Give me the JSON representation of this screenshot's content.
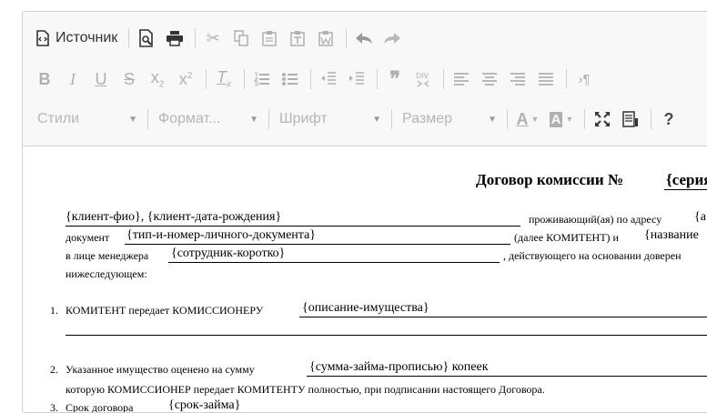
{
  "toolbar": {
    "source_label": "Источник",
    "styles_label": "Стили",
    "format_label": "Формат...",
    "font_label": "Шрифт",
    "size_label": "Размер"
  },
  "document": {
    "title": "Договор комиссии №",
    "title_serial": "{серия",
    "p1_client": "{клиент-фио}, {клиент-дата-рождения}",
    "p1_lives": "проживающий(ая) по адресу",
    "p1_lives_tail": "{а",
    "p2_doc": "документ",
    "p2_doc_ph": "{тип-и-номер-личного-документа}",
    "p2_komitent": "(далее КОМИТЕНТ) и",
    "p2_name": "{название",
    "p3_face": "в лице менеджера",
    "p3_manager": "{сотрудник-коротко}",
    "p3_acting": ", действующего на основании доверен",
    "p4_following": "нижеследующем:",
    "item1_num": "1.",
    "item1_text": "КОМИТЕНТ передает КОМИССИОНЕРУ",
    "item1_ph": "{описание-имущества}",
    "item2_num": "2.",
    "item2_text": "Указанное имущество оценено на сумму",
    "item2_ph": "{сумма-займа-прописью} копеек",
    "item2_line2": "которую КОМИССИОНЕР передает КОМИТЕНТУ полностью, при подписании настоящего Договора.",
    "item3_num": "3.",
    "item3_text": "Срок договора",
    "item3_ph": "{срок-займа}"
  }
}
